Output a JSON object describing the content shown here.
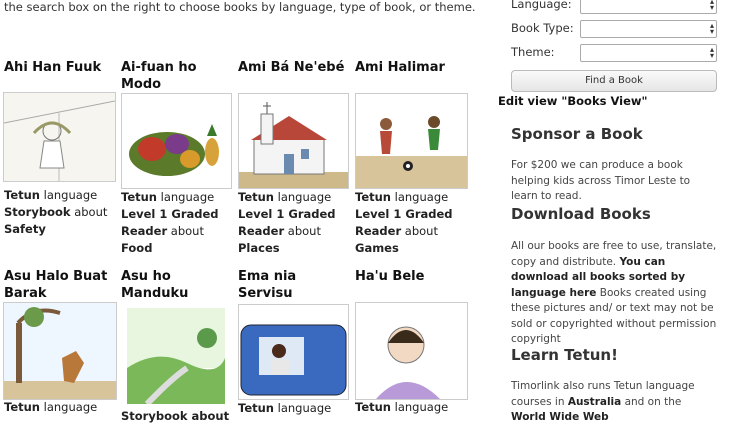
{
  "intro": "the search box on the right to choose books by language, type of book, or theme.",
  "books": [
    {
      "title": "Ahi Han Fuuk",
      "lang": "Tetun",
      "lang_suffix": "language",
      "type": "Storybook",
      "about_word": "about",
      "theme": "Safety"
    },
    {
      "title": "Ai-fuan ho Modo",
      "lang": "Tetun",
      "lang_suffix": "language",
      "type": "Level 1 Graded Reader",
      "about_word": "about",
      "theme": "Food"
    },
    {
      "title": "Ami Bá Ne'ebé",
      "lang": "Tetun",
      "lang_suffix": "language",
      "type": "Level 1 Graded Reader",
      "about_word": "about",
      "theme": "Places"
    },
    {
      "title": "Ami Halimar",
      "lang": "Tetun",
      "lang_suffix": "language",
      "type": "Level 1 Graded Reader",
      "about_word": "about",
      "theme": "Games"
    },
    {
      "title": "Asu Halo Buat Barak",
      "lang": "Tetun",
      "lang_suffix": "language"
    },
    {
      "title": "Asu ho Manduku",
      "lang": "",
      "lang_suffix": "",
      "type": "Storybook about"
    },
    {
      "title": "Ema nia Servisu",
      "lang": "Tetun",
      "lang_suffix": "language"
    },
    {
      "title": "Ha'u Bele",
      "lang": "Tetun",
      "lang_suffix": "language"
    }
  ],
  "sidebar": {
    "language_label": "Language:",
    "booktype_label": "Book Type:",
    "theme_label": "Theme:",
    "find_button": "Find a Book",
    "edit_view": "Edit view \"Books View\"",
    "sponsor": {
      "heading": "Sponsor a Book",
      "text": "For $200 we can produce a book helping kids across Timor Leste to learn to read."
    },
    "download": {
      "heading": "Download Books",
      "text1": "All our books are free to use, translate, copy and distribute.",
      "text_bold": "You can download all books sorted by language here",
      "text2": "Books created using these pictures and/ or text may not be sold or copyrighted without permission copyright"
    },
    "learn": {
      "heading": "Learn Tetun!",
      "text1": "Timorlink also runs Tetun language courses in",
      "bold1": "Australia",
      "text2": "and on the",
      "bold2": "World Wide Web"
    }
  }
}
